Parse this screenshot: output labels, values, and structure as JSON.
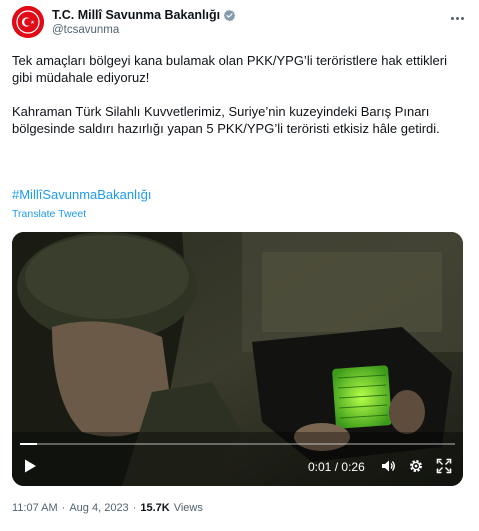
{
  "account": {
    "display_name": "T.C. Millî Savunma Bakanlığı",
    "handle": "@tcsavunma",
    "verified_icon": "verified-badge-icon",
    "avatar_color": "#e30a17"
  },
  "tweet": {
    "paragraph_1": "Tek amaçları bölgeyi kana bulamak olan PKK/YPG’li teröristlere hak ettikleri gibi müdahale ediyoruz!",
    "paragraph_2": "Kahraman Türk Silahlı Kuvvetlerimiz, Suriye’nin kuzeyindeki Barış Pınarı bölgesinde saldırı hazırlığı yapan 5 PKK/YPG’li teröristi etkisiz hâle getirdi.",
    "hashtag": "#MillîSavunmaBakanlığı",
    "translate_label": "Translate Tweet"
  },
  "video": {
    "current_time": "0:01",
    "separator": "/",
    "duration": "0:26",
    "progress_fraction": 0.04
  },
  "meta": {
    "time": "11:07 AM",
    "dot_1": "·",
    "date": "Aug 4, 2023",
    "dot_2": "·",
    "views_count": "15.7K",
    "views_label": "Views"
  },
  "colors": {
    "link": "#1d9bf0",
    "secondary_text": "#536471",
    "primary_text": "#0f1419"
  }
}
